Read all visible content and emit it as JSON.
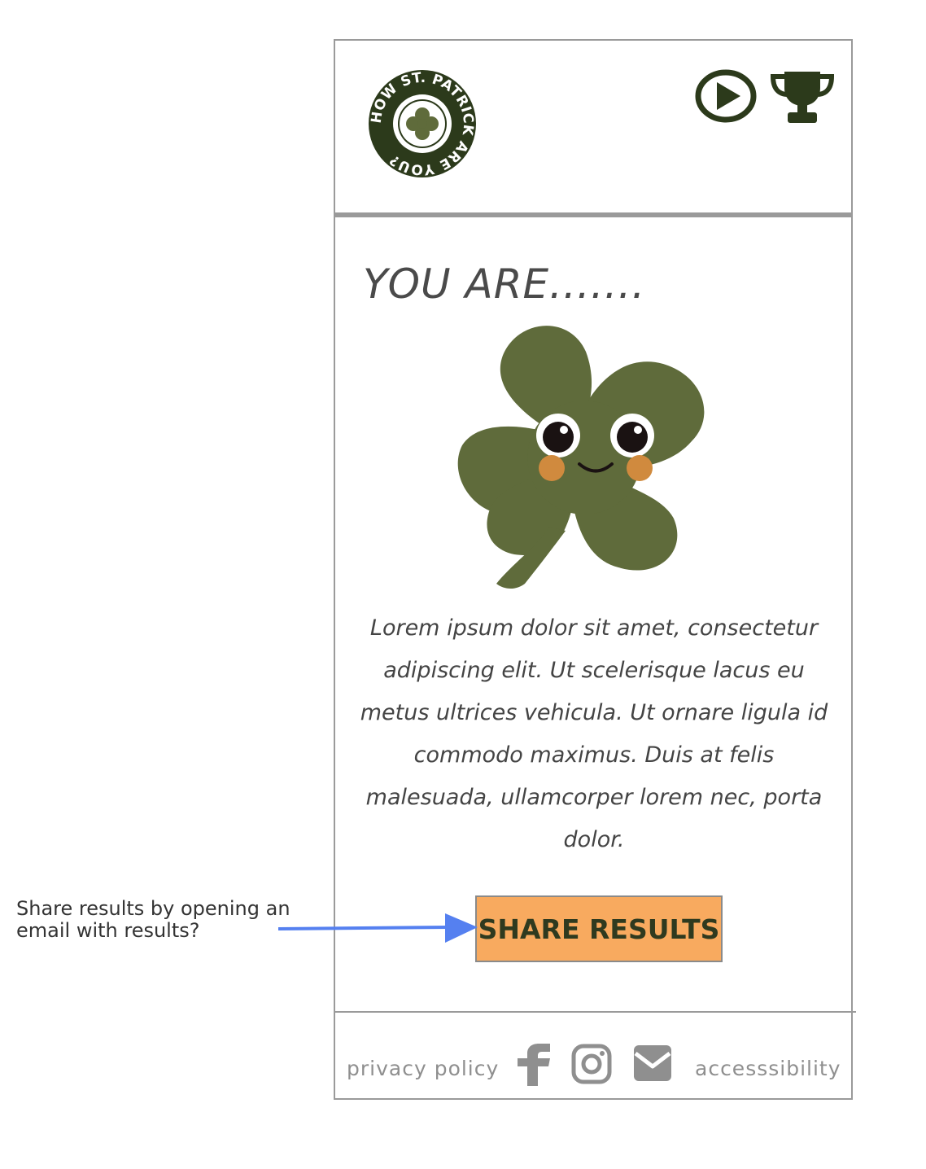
{
  "header": {
    "logo_text": "HOW ST. PATRICK ARE YOU?",
    "icons": [
      "play-icon",
      "trophy-icon"
    ]
  },
  "main": {
    "heading": "YOU ARE.......",
    "description": "Lorem ipsum dolor sit amet, consectetur adipiscing elit. Ut scelerisque lacus eu metus ultrices vehicula. Ut ornare ligula id commodo maximus. Duis at felis malesuada, ullamcorper lorem nec, porta dolor.",
    "share_button": "SHARE RESULTS"
  },
  "footer": {
    "privacy": "privacy policy",
    "accessibility": "accesssibility",
    "social_icons": [
      "facebook-icon",
      "instagram-icon",
      "email-icon"
    ]
  },
  "annotation": {
    "line1": "Share results by opening an",
    "line2": "email with results?"
  },
  "colors": {
    "brand_dark_green": "#2c3a1b",
    "shamrock_green": "#5f6b3b",
    "cheek_orange": "#d08a3e",
    "share_button": "#f8aa5f",
    "frame_gray": "#9a9a9a",
    "annotation_arrow": "#5580f0"
  }
}
